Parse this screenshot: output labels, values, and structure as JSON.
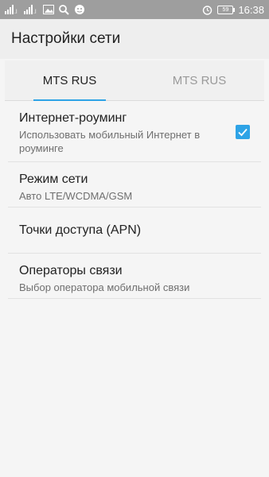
{
  "statusbar": {
    "time": "16:38",
    "battery_level": "59",
    "icons": [
      "signal-icon",
      "signal-icon",
      "image-icon",
      "search-icon",
      "notification-icon",
      "alarm-icon",
      "battery-icon"
    ]
  },
  "appbar": {
    "title": "Настройки сети"
  },
  "tabs": [
    {
      "label": "MTS RUS",
      "active": true
    },
    {
      "label": "MTS RUS",
      "active": false
    }
  ],
  "settings": {
    "roaming": {
      "title": "Интернет-роуминг",
      "subtitle": "Использовать мобильный Интернет в роуминге",
      "checked": true
    },
    "network_mode": {
      "title": "Режим сети",
      "subtitle": "Авто LTE/WCDMA/GSM"
    },
    "apn": {
      "title": "Точки доступа (APN)"
    },
    "operators": {
      "title": "Операторы связи",
      "subtitle": "Выбор оператора мобильной связи"
    }
  },
  "colors": {
    "accent": "#2ea3e6",
    "statusbar": "#9e9e9e",
    "background": "#f5f5f5"
  }
}
